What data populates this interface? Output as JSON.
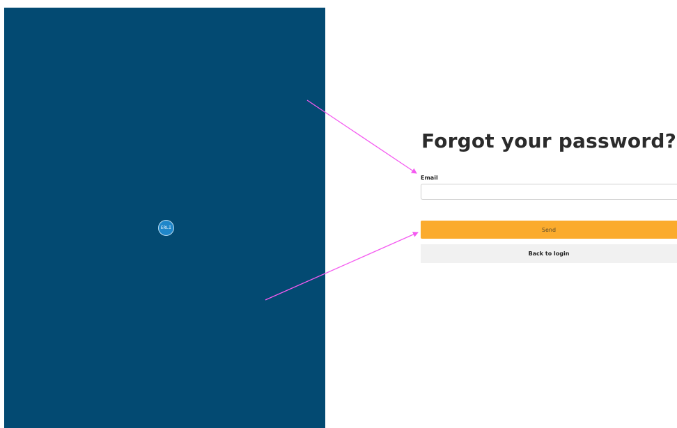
{
  "branding": {
    "logo_text": "ERLI",
    "panel_color": "#034a72",
    "logo_color": "#1f86c9"
  },
  "form": {
    "title": "Forgot your password?",
    "email_label": "Email",
    "email_value": "",
    "email_placeholder": "",
    "send_label": "Send",
    "back_label": "Back to login"
  },
  "colors": {
    "primary_button": "#fbab2d",
    "secondary_button": "#f1f1f1",
    "annotation_arrow": "#f45af0"
  },
  "annotations": {
    "arrow_icon": "arrow-pointer"
  }
}
